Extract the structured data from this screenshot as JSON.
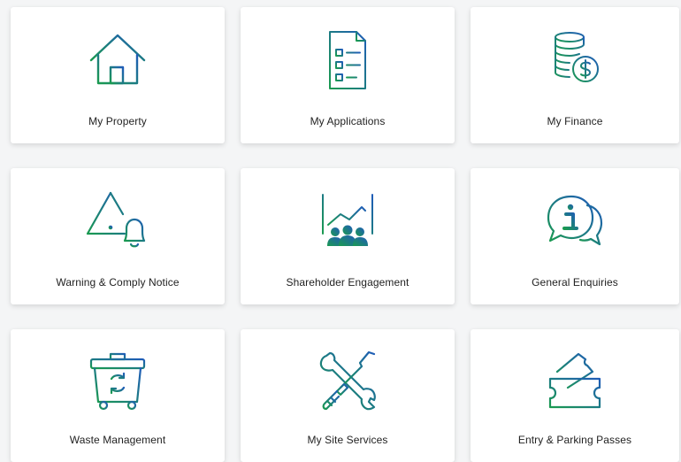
{
  "tiles": [
    {
      "label": "My Property",
      "icon": "house-icon"
    },
    {
      "label": "My Applications",
      "icon": "document-checklist-icon"
    },
    {
      "label": "My Finance",
      "icon": "coins-dollar-icon"
    },
    {
      "label": "Warning & Comply Notice",
      "icon": "warning-bell-icon"
    },
    {
      "label": "Shareholder Engagement",
      "icon": "presentation-audience-icon"
    },
    {
      "label": "General Enquiries",
      "icon": "info-chat-icon"
    },
    {
      "label": "Waste Management",
      "icon": "recycle-bin-icon"
    },
    {
      "label": "My Site Services",
      "icon": "wrench-screwdriver-icon"
    },
    {
      "label": "Entry & Parking Passes",
      "icon": "tickets-icon"
    }
  ],
  "colors": {
    "gradient_start": "#1a9a50",
    "gradient_end": "#1f5cb8"
  }
}
